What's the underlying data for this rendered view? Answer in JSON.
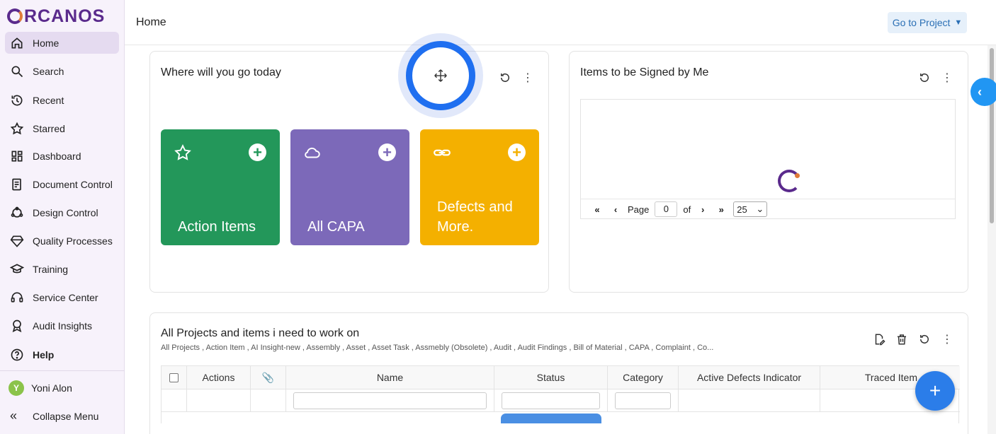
{
  "brand": {
    "logo_text": "RCANOS",
    "accent": "#5a2a8c",
    "accent2": "#e07b39"
  },
  "sidebar": {
    "items": [
      {
        "label": "Home",
        "icon": "home-icon",
        "active": true
      },
      {
        "label": "Search",
        "icon": "search-icon"
      },
      {
        "label": "Recent",
        "icon": "history-icon"
      },
      {
        "label": "Starred",
        "icon": "star-icon"
      },
      {
        "label": "Dashboard",
        "icon": "dashboard-icon"
      },
      {
        "label": "Document Control",
        "icon": "document-icon"
      },
      {
        "label": "Design Control",
        "icon": "design-icon"
      },
      {
        "label": "Quality Processes",
        "icon": "diamond-icon"
      },
      {
        "label": "Training",
        "icon": "graduation-cap-icon"
      },
      {
        "label": "Service Center",
        "icon": "headset-icon"
      },
      {
        "label": "Audit Insights",
        "icon": "award-icon"
      },
      {
        "label": "Help",
        "icon": "help-icon"
      }
    ],
    "user": {
      "initial": "Y",
      "name": "Yoni Alon"
    },
    "collapse_label": "Collapse Menu"
  },
  "header": {
    "title": "Home",
    "go_to_project": "Go to Project"
  },
  "widgets": {
    "where": {
      "title": "Where will you go today",
      "tiles": [
        {
          "label": "Action Items",
          "color": "#23975a",
          "icon": "star-icon"
        },
        {
          "label": "All CAPA",
          "color": "#7c69b9",
          "icon": "cloud-icon"
        },
        {
          "label": "Defects and More.",
          "color": "#f4b000",
          "icon": "link-icon"
        }
      ]
    },
    "signed": {
      "title": "Items to be Signed by Me",
      "pager": {
        "page_label": "Page",
        "page_value": "0",
        "of_label": "of",
        "page_size": "25"
      }
    },
    "projects": {
      "title": "All Projects and items i need to work on",
      "subtitle": "All Projects , Action Item , AI Insight-new , Assembly , Asset , Asset Task , Assmebly (Obsolete) , Audit , Audit Findings , Bill of Material , CAPA , Complaint , Co...",
      "columns": [
        "Actions",
        "Name",
        "Status",
        "Category",
        "Active Defects Indicator",
        "Traced Item"
      ]
    }
  }
}
